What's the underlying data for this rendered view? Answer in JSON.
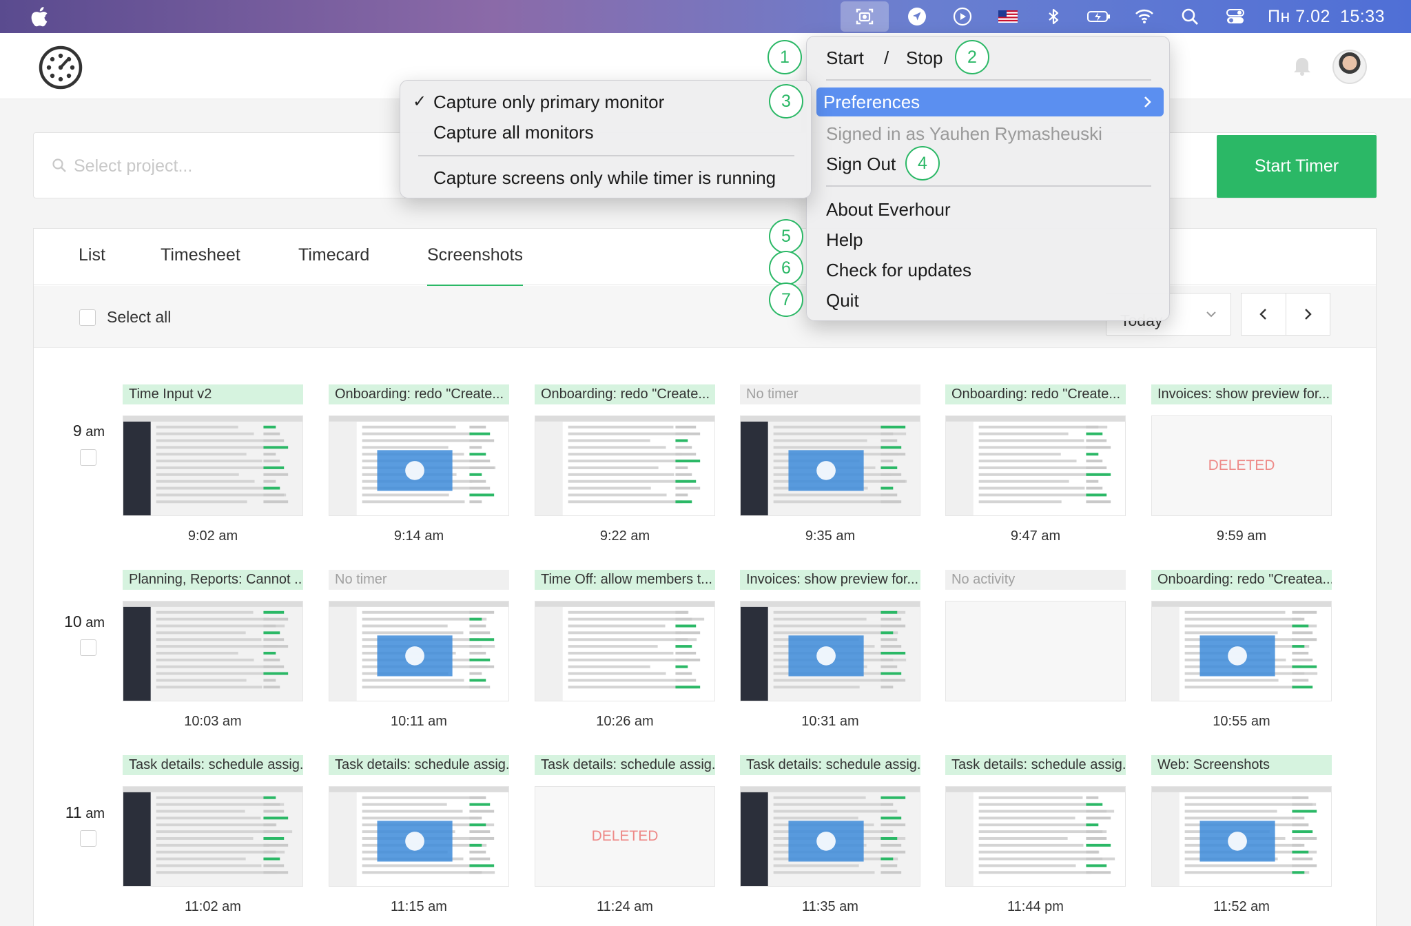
{
  "menubar": {
    "clock_day": "Пн 7.02",
    "clock_time": "15:33",
    "icons": [
      "everhour-screenshot-icon",
      "location-icon",
      "play-icon",
      "us-flag-icon",
      "bluetooth-icon",
      "battery-icon",
      "wifi-icon",
      "search-icon",
      "control-center-icon"
    ]
  },
  "header": {
    "logo": "everhour-logo-icon",
    "notification_icon": "bell-icon"
  },
  "project_bar": {
    "placeholder": "Select project...",
    "start_button": "Start Timer",
    "accent_color": "#2bb866"
  },
  "tabs": [
    "List",
    "Timesheet",
    "Timecard",
    "Screenshots"
  ],
  "active_tab": "Screenshots",
  "toolbar": {
    "select_all": "Select all",
    "date_value": "Today"
  },
  "rows": [
    {
      "hour": "9",
      "suffix": "am",
      "cells": [
        {
          "task": "Time Input v2",
          "time": "9:02 am",
          "state": "shot"
        },
        {
          "task": "Onboarding: redo \"Create...",
          "time": "9:14 am",
          "state": "shot"
        },
        {
          "task": "Onboarding: redo \"Create...",
          "time": "9:22 am",
          "state": "shot"
        },
        {
          "task": "No timer",
          "time": "9:35 am",
          "state": "shot"
        },
        {
          "task": "Onboarding: redo \"Create...",
          "time": "9:47 am",
          "state": "shot"
        },
        {
          "task": "Invoices: show preview for...",
          "time": "9:59 am",
          "state": "deleted",
          "label": "DELETED"
        }
      ]
    },
    {
      "hour": "10",
      "suffix": "am",
      "cells": [
        {
          "task": "Planning, Reports: Cannot ...",
          "time": "10:03 am",
          "state": "shot"
        },
        {
          "task": "No timer",
          "time": "10:11 am",
          "state": "shot"
        },
        {
          "task": "Time Off: allow members t...",
          "time": "10:26 am",
          "state": "shot"
        },
        {
          "task": "Invoices: show preview for...",
          "time": "10:31 am",
          "state": "shot"
        },
        {
          "task": "No activity",
          "time": "",
          "state": "blank"
        },
        {
          "task": "Onboarding: redo \"Createa...",
          "time": "10:55 am",
          "state": "shot"
        }
      ]
    },
    {
      "hour": "11",
      "suffix": "am",
      "cells": [
        {
          "task": "Task details: schedule assig...",
          "time": "11:02 am",
          "state": "shot"
        },
        {
          "task": "Task details: schedule assig...",
          "time": "11:15 am",
          "state": "shot"
        },
        {
          "task": "Task details: schedule assig...",
          "time": "11:24 am",
          "state": "deleted",
          "label": "DELETED"
        },
        {
          "task": "Task details: schedule assig...",
          "time": "11:35 am",
          "state": "shot"
        },
        {
          "task": "Task details: schedule assig...",
          "time": "11:44 pm",
          "state": "shot"
        },
        {
          "task": "Web: Screenshots",
          "time": "11:52 am",
          "state": "shot"
        }
      ]
    }
  ],
  "tray_menu": {
    "start": "Start",
    "slash": "/",
    "stop": "Stop",
    "preferences": "Preferences",
    "signed_in": "Signed in as Yauhen Rymasheuski",
    "sign_out": "Sign Out",
    "about": "About Everhour",
    "help": "Help",
    "updates": "Check for updates",
    "quit": "Quit"
  },
  "preferences_submenu": {
    "checkmark": "✓",
    "primary": "Capture only primary monitor",
    "all": "Capture all monitors",
    "timer_only": "Capture screens only while timer is running"
  },
  "callouts": [
    "1",
    "2",
    "3",
    "4",
    "5",
    "6",
    "7"
  ]
}
